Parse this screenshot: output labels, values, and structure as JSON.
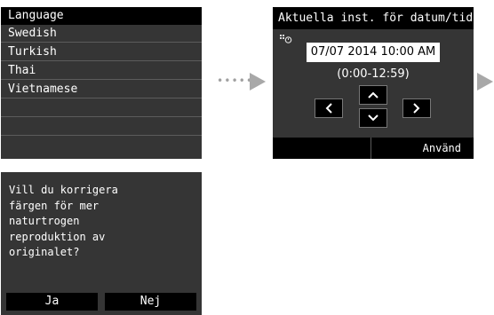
{
  "language_screen": {
    "title": "Language",
    "items": [
      "Swedish",
      "Turkish",
      "Thai",
      "Vietnamese",
      "",
      ""
    ]
  },
  "arrows": {
    "dots": "•••••"
  },
  "datetime_screen": {
    "title": "Aktuella inst. för datum/tid",
    "clock_icon": "clock-settings-icon",
    "date_value": "07/07 2014 10:00 AM",
    "range_text": "(0:00-12:59)",
    "apply_label": "Använd"
  },
  "dialog_screen": {
    "message": "Vill du korrigera\nfärgen för mer\nnaturtrogen\nreproduktion av\noriginalet?",
    "yes_label": "Ja",
    "no_label": "Nej"
  }
}
